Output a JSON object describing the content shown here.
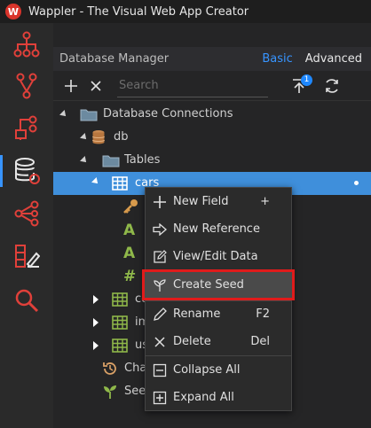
{
  "window": {
    "title": "Wappler - The Visual Web App Creator",
    "logo_letter": "W"
  },
  "activity_bar": {
    "items": [
      {
        "icon": "hierarchy-icon"
      },
      {
        "icon": "branch-icon"
      },
      {
        "icon": "flow-icon"
      },
      {
        "icon": "database-icon"
      },
      {
        "icon": "share-icon"
      },
      {
        "icon": "design-icon"
      },
      {
        "icon": "search-icon"
      }
    ]
  },
  "panel": {
    "title": "Database Manager",
    "tab_basic": "Basic",
    "tab_advanced": "Advanced",
    "search_placeholder": "Search",
    "badge_count": "1"
  },
  "tree": [
    {
      "label": "Database Connections",
      "icon": "folder-icon"
    },
    {
      "label": "db",
      "icon": "database-icon"
    },
    {
      "label": "Tables",
      "icon": "folder-icon"
    },
    {
      "label": "cars",
      "icon": "table-icon",
      "selected": true
    },
    {
      "label": "",
      "icon": "key-icon"
    },
    {
      "label": "",
      "icon": "text-icon"
    },
    {
      "label": "",
      "icon": "text-icon"
    },
    {
      "label": "",
      "icon": "number-icon"
    },
    {
      "label": "co",
      "icon": "table-icon"
    },
    {
      "label": "im",
      "icon": "table-icon"
    },
    {
      "label": "us",
      "icon": "table-icon"
    },
    {
      "label": "Cha",
      "icon": "history-icon"
    },
    {
      "label": "Seed",
      "icon": "sprout-icon"
    }
  ],
  "context_menu": {
    "items": [
      {
        "label": "New Field",
        "shortcut": "+",
        "icon": "plus-icon"
      },
      {
        "label": "New Reference",
        "shortcut": "",
        "icon": "arrow-icon"
      },
      {
        "label": "View/Edit Data",
        "shortcut": "",
        "icon": "edit-icon"
      },
      {
        "label": "Create Seed",
        "shortcut": "",
        "icon": "sprout-icon",
        "highlighted": true
      },
      {
        "label": "Rename",
        "shortcut": "F2",
        "icon": "pencil-icon"
      },
      {
        "label": "Delete",
        "shortcut": "Del",
        "icon": "close-icon"
      },
      {
        "label": "Collapse All",
        "shortcut": "",
        "icon": "collapse-icon"
      },
      {
        "label": "Expand All",
        "shortcut": "",
        "icon": "expand-icon"
      }
    ]
  },
  "colors": {
    "accent": "#3794ff",
    "selection": "#3f8fdb",
    "highlight_border": "#e01b1b",
    "icon_red": "#e0403a",
    "table_green": "#8fb84a",
    "key_orange": "#d79a4c"
  }
}
